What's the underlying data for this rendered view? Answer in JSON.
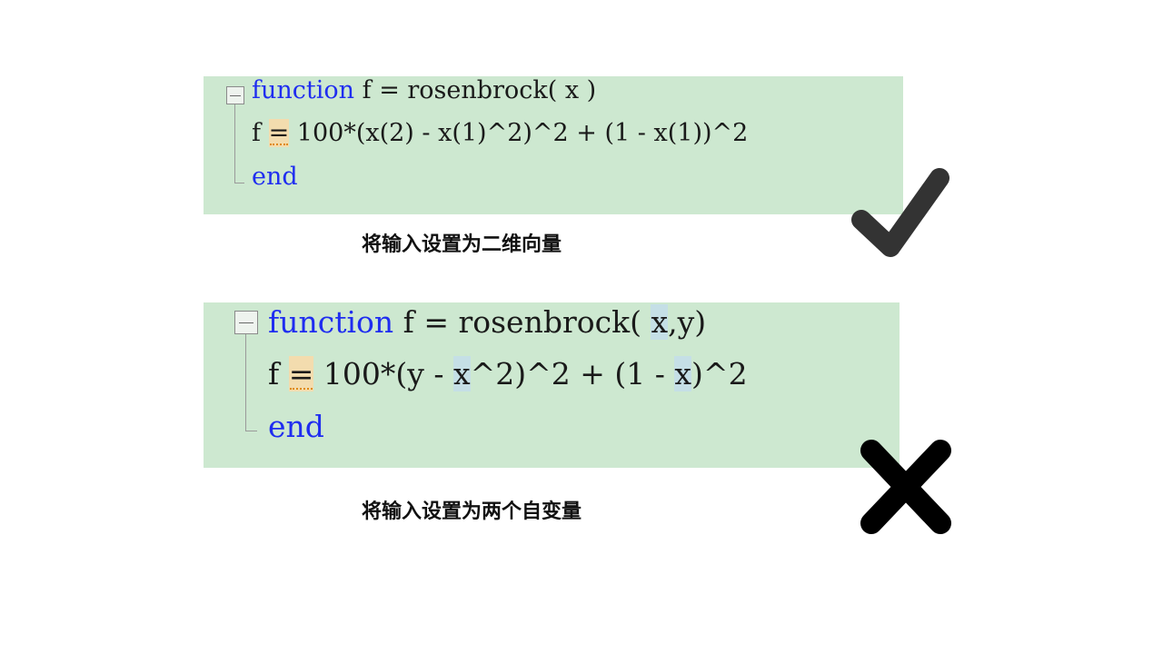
{
  "panel_1": {
    "line1": {
      "keyword": "function",
      "rest": " f = rosenbrock( x )"
    },
    "line2": {
      "start": "f ",
      "eq": "=",
      "rest": " 100*(x(2) - x(1)^2)^2 + (1 - x(1))^2"
    },
    "line3": {
      "keyword": "end"
    },
    "caption": "将输入设置为二维向量",
    "status_icon": "check-icon"
  },
  "panel_2": {
    "line1": {
      "keyword": "function",
      "a": " f = rosenbrock( ",
      "x": "x",
      "b": ",y)"
    },
    "line2": {
      "start": "f ",
      "eq": "=",
      "a": " 100*(y - ",
      "x1": "x",
      "b": "^2)^2 + (1 - ",
      "x2": "x",
      "c": ")^2"
    },
    "line3": {
      "keyword": "end"
    },
    "caption": "将输入设置为两个自变量",
    "status_icon": "cross-icon"
  },
  "colors": {
    "panel_bg": "#cde8d0",
    "keyword": "#1f2df0",
    "eq_highlight": "#f3dcae",
    "var_highlight": "#c5dfe6",
    "icon": "#333333",
    "cross": "#000000"
  }
}
